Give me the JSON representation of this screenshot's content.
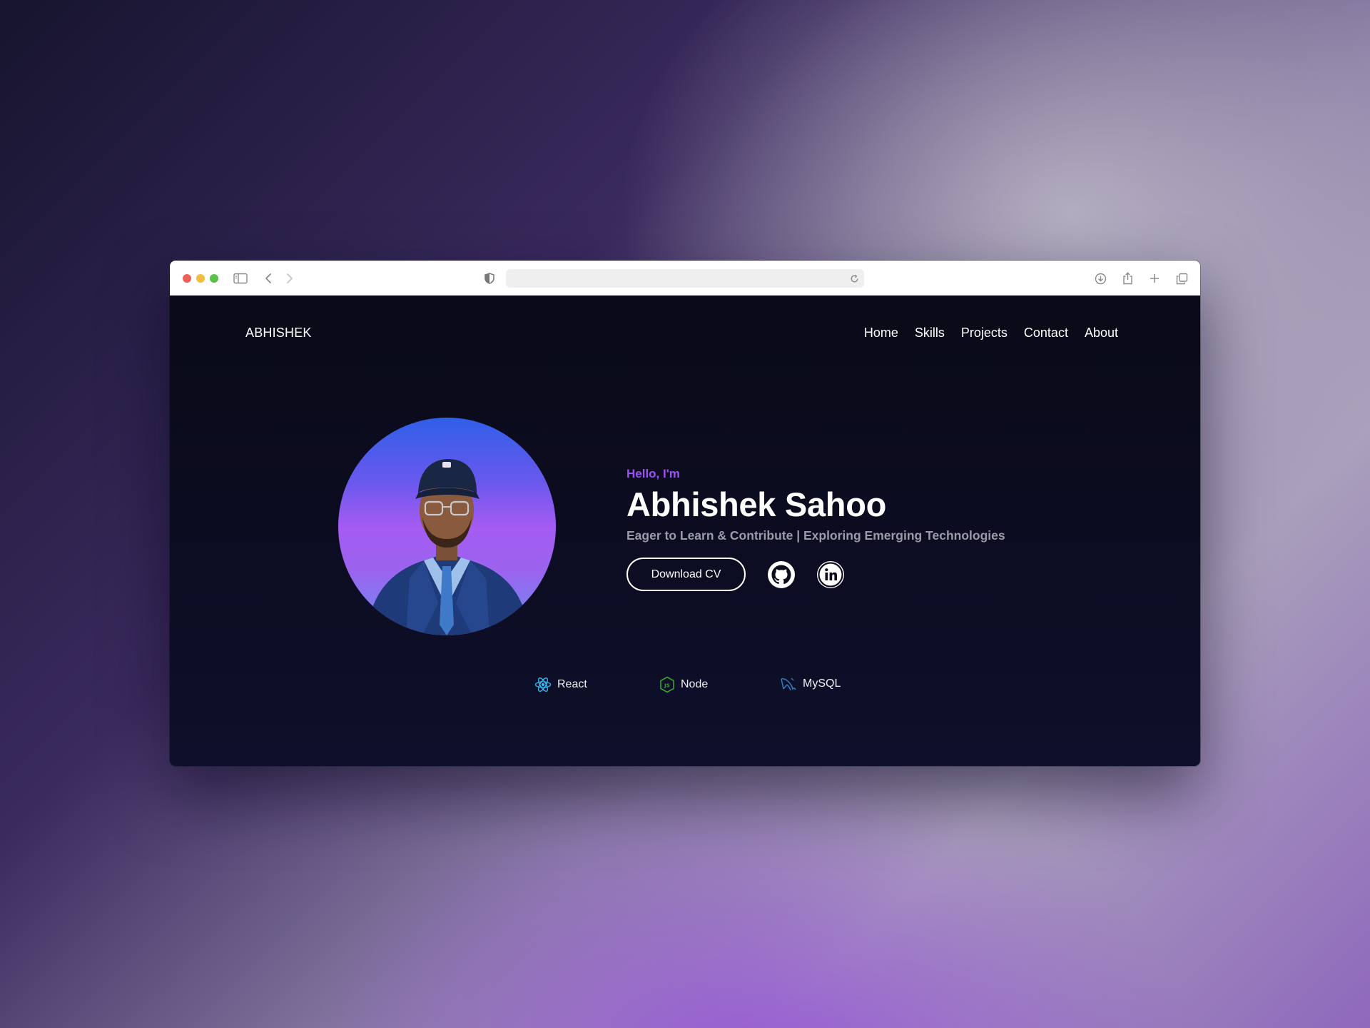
{
  "browser": {
    "url": "",
    "colors": {
      "close": "#ee5f58",
      "minimize": "#f4bc40",
      "zoom": "#5ac249"
    }
  },
  "site": {
    "brand": "ABHISHEK",
    "nav": [
      {
        "label": "Home"
      },
      {
        "label": "Skills"
      },
      {
        "label": "Projects"
      },
      {
        "label": "Contact"
      },
      {
        "label": "About"
      }
    ]
  },
  "hero": {
    "greeting": "Hello, I'm",
    "name": "Abhishek Sahoo",
    "tagline": "Eager to Learn & Contribute | Exploring Emerging Technologies",
    "cta_label": "Download CV",
    "socials": [
      {
        "icon": "github-icon"
      },
      {
        "icon": "linkedin-icon"
      }
    ],
    "accent_color": "#9a52f5"
  },
  "tech_stack": [
    {
      "label": "React",
      "icon": "react-icon",
      "color": "#38bdf8"
    },
    {
      "label": "Node",
      "icon": "nodejs-icon",
      "color": "#3fa037"
    },
    {
      "label": "MySQL",
      "icon": "mysql-icon",
      "color": "#2f7fc1"
    }
  ]
}
